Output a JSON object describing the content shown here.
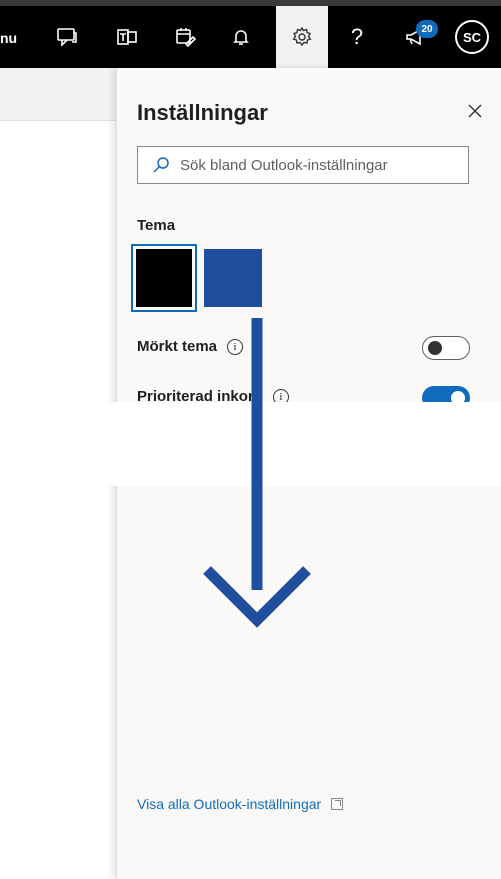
{
  "topbar": {
    "menu_partial": "nu",
    "help_label": "?",
    "notification_badge": "20",
    "avatar_initials": "SC"
  },
  "panel": {
    "title": "Inställningar",
    "search_placeholder": "Sök bland Outlook-inställningar",
    "theme_section": "Tema",
    "dark_theme_label": "Mörkt tema",
    "dark_theme_on": false,
    "focused_inbox_label": "Prioriterad inkorg",
    "focused_inbox_on": true,
    "footer_link": "Visa alla Outlook-inställningar",
    "info_glyph": "i"
  },
  "colors": {
    "accent": "#0f6cbd",
    "theme_swatch_black": "#000000",
    "theme_swatch_blue": "#1f4e9f",
    "arrow": "#1f4e9f"
  },
  "icons": [
    "chat-icon",
    "teams-icon",
    "calendar-edit-icon",
    "bell-icon",
    "gear-icon",
    "help-icon",
    "megaphone-icon"
  ]
}
